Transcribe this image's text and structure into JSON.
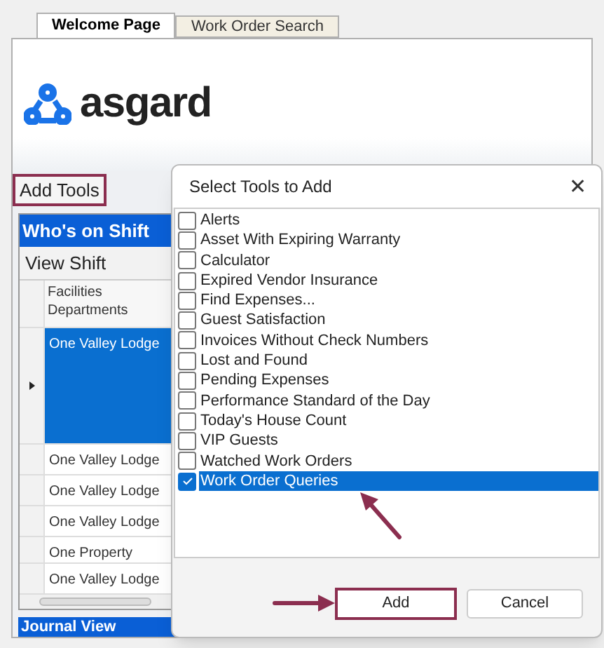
{
  "tabs": [
    {
      "label": "Welcome Page",
      "selected": true
    },
    {
      "label": "Work Order Search",
      "selected": false
    }
  ],
  "logo": {
    "text": "asgard"
  },
  "add_tools": {
    "label": "Add Tools"
  },
  "shift_panel": {
    "title": "Who's on Shift",
    "view_button": "View Shift",
    "column": "Facilities Departments",
    "rows": [
      {
        "text": "One Valley Lodge",
        "selected": true
      },
      {
        "text": "One Valley Lodge",
        "selected": false
      },
      {
        "text": "One Valley Lodge",
        "selected": false
      },
      {
        "text": "One Valley Lodge",
        "selected": false
      },
      {
        "text": "One Property",
        "selected": false
      },
      {
        "text": "One Valley Lodge",
        "selected": false
      }
    ]
  },
  "journal": {
    "title": "Journal View"
  },
  "dialog": {
    "title": "Select Tools to Add",
    "close": "✕",
    "items": [
      {
        "label": "Alerts",
        "checked": false,
        "selected": false
      },
      {
        "label": "Asset With Expiring Warranty",
        "checked": false,
        "selected": false
      },
      {
        "label": "Calculator",
        "checked": false,
        "selected": false
      },
      {
        "label": "Expired Vendor Insurance",
        "checked": false,
        "selected": false
      },
      {
        "label": "Find Expenses...",
        "checked": false,
        "selected": false
      },
      {
        "label": "Guest Satisfaction",
        "checked": false,
        "selected": false
      },
      {
        "label": "Invoices Without Check Numbers",
        "checked": false,
        "selected": false
      },
      {
        "label": "Lost and Found",
        "checked": false,
        "selected": false
      },
      {
        "label": "Pending Expenses",
        "checked": false,
        "selected": false
      },
      {
        "label": "Performance Standard of the Day",
        "checked": false,
        "selected": false
      },
      {
        "label": "Today's House Count",
        "checked": false,
        "selected": false
      },
      {
        "label": "VIP Guests",
        "checked": false,
        "selected": false
      },
      {
        "label": "Watched Work Orders",
        "checked": false,
        "selected": false
      },
      {
        "label": "Work Order Queries",
        "checked": true,
        "selected": true
      }
    ],
    "buttons": [
      {
        "label": "Add",
        "kind": "primary"
      },
      {
        "label": "Cancel",
        "kind": "secondary"
      }
    ]
  }
}
